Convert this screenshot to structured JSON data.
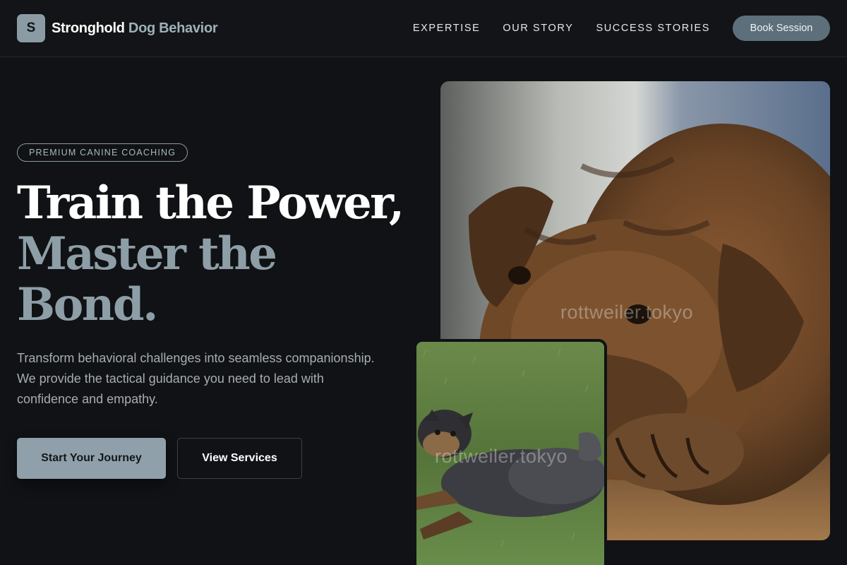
{
  "brand": {
    "initial": "S",
    "name_part1": "Stronghold",
    "name_part2": "Dog Behavior"
  },
  "nav": {
    "links": [
      "EXPERTISE",
      "OUR STORY",
      "SUCCESS STORIES"
    ],
    "cta_label": "Book Session"
  },
  "hero": {
    "badge": "PREMIUM CANINE COACHING",
    "headline_line1": "Train the Power,",
    "headline_line2": "Master the",
    "headline_line3": "Bond.",
    "subtext": "Transform behavioral challenges into seamless companionship. We provide the tactical guidance you need to lead with confidence and empathy.",
    "primary_cta": "Start Your Journey",
    "secondary_cta": "View Services"
  },
  "images": {
    "main_watermark": "rottweiler.tokyo",
    "small_watermark": "rottweiler.tokyo"
  },
  "colors": {
    "background": "#101215",
    "accent": "#8fa0aa",
    "accent_dark": "#5c6f7a",
    "muted_heading": "#8d9ea7"
  }
}
